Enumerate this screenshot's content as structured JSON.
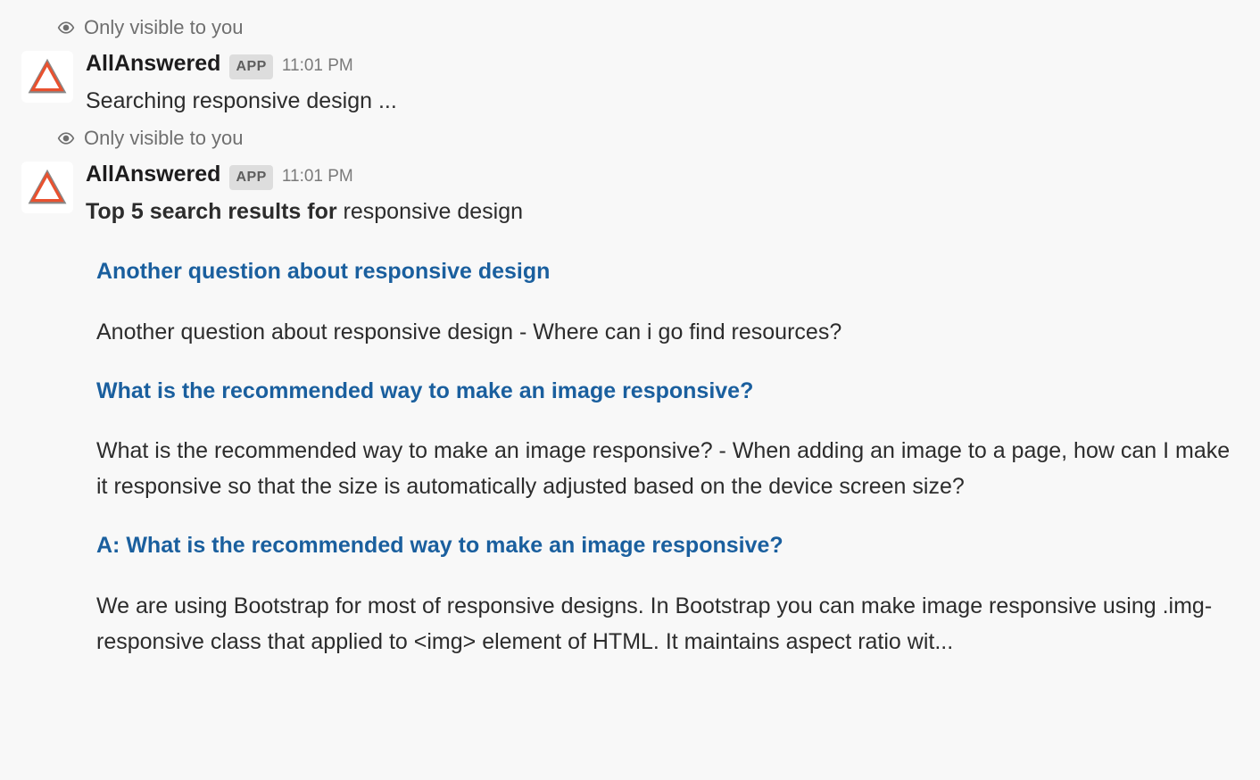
{
  "messages": [
    {
      "visibility_label": "Only visible to you",
      "bot_name": "AllAnswered",
      "app_badge": "APP",
      "timestamp": "11:01 PM",
      "body": "Searching responsive design ..."
    },
    {
      "visibility_label": "Only visible to you",
      "bot_name": "AllAnswered",
      "app_badge": "APP",
      "timestamp": "11:01 PM",
      "result_header_bold": "Top 5 search results for",
      "result_header_query": "responsive design",
      "results": [
        {
          "title": "Another question about responsive design",
          "body": "Another question about responsive design - Where can i go find resources?"
        },
        {
          "title": "What is the recommended way to make an image responsive?",
          "body": "What is the recommended way to make an image responsive? - When adding an image to a page, how can I make it responsive so that the size is automatically adjusted based on the device screen size?"
        },
        {
          "title": "A: What is the recommended way to make an image responsive?",
          "body": "We are using Bootstrap for most of responsive designs. In Bootstrap you can make image responsive using .img-responsive class that applied to <img> element of HTML. It maintains aspect ratio wit..."
        }
      ]
    }
  ]
}
